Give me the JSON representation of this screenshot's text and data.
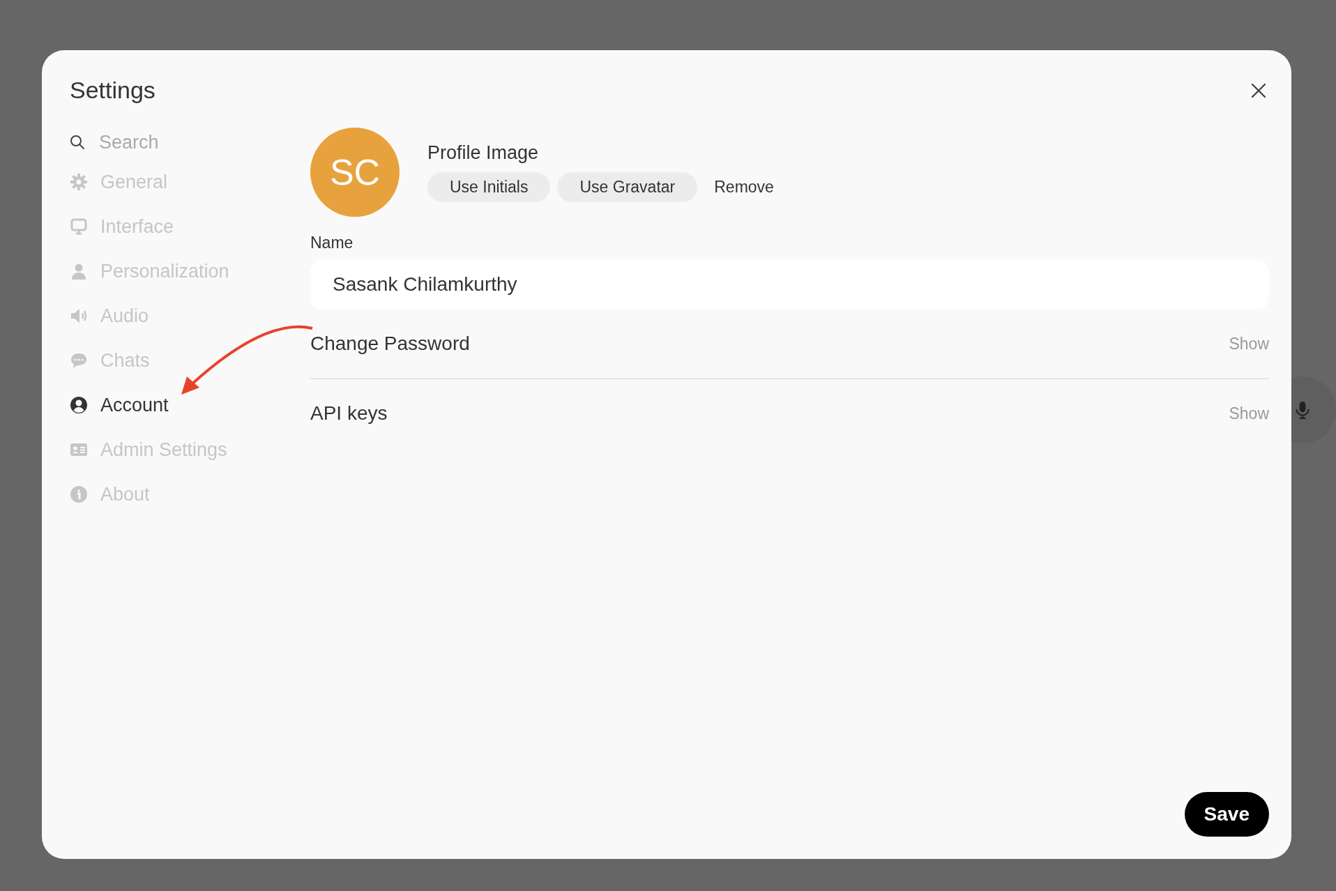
{
  "window": {
    "title": "Settings"
  },
  "search": {
    "placeholder": "Search"
  },
  "sidebar": {
    "items": [
      {
        "label": "General",
        "kind": "gear",
        "selected": false
      },
      {
        "label": "Interface",
        "kind": "monitor",
        "selected": false
      },
      {
        "label": "Personalization",
        "kind": "person",
        "selected": false
      },
      {
        "label": "Audio",
        "kind": "speaker",
        "selected": false
      },
      {
        "label": "Chats",
        "kind": "chat",
        "selected": false
      },
      {
        "label": "Account",
        "kind": "account",
        "selected": true
      },
      {
        "label": "Admin Settings",
        "kind": "card",
        "selected": false
      },
      {
        "label": "About",
        "kind": "info",
        "selected": false
      }
    ]
  },
  "profile": {
    "initials": "SC",
    "title": "Profile Image",
    "buttons": [
      {
        "label": "Use Initials",
        "kind": "pill"
      },
      {
        "label": "Use Gravatar",
        "kind": "pill"
      },
      {
        "label": "Remove",
        "kind": "plain"
      }
    ]
  },
  "name": {
    "label": "Name",
    "value": "Sasank Chilamkurthy"
  },
  "sections": [
    {
      "title": "Change Password",
      "toggle": "Show"
    },
    {
      "title": "API keys",
      "toggle": "Show"
    }
  ],
  "save_button": "Save"
}
